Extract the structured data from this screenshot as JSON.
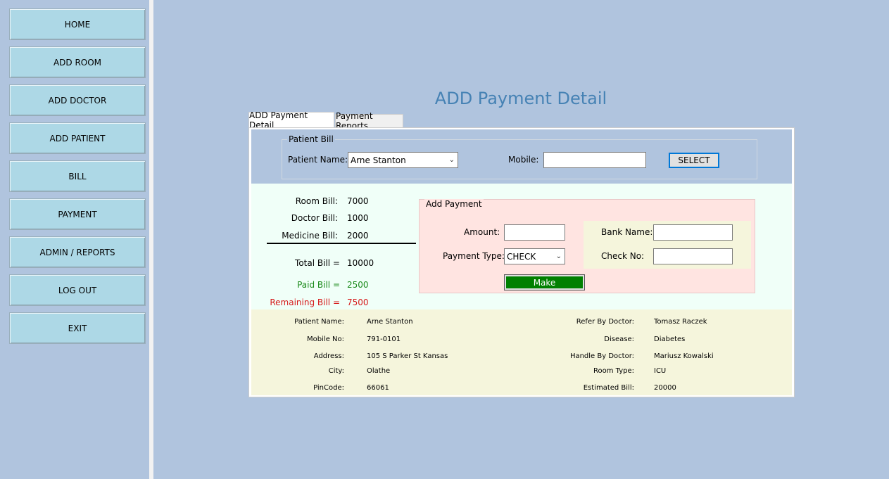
{
  "nav": {
    "items": [
      {
        "label": "HOME"
      },
      {
        "label": "ADD ROOM"
      },
      {
        "label": "ADD DOCTOR"
      },
      {
        "label": "ADD PATIENT"
      },
      {
        "label": "BILL"
      },
      {
        "label": "PAYMENT"
      },
      {
        "label": "ADMIN / REPORTS"
      },
      {
        "label": "LOG OUT"
      },
      {
        "label": "EXIT"
      }
    ]
  },
  "page": {
    "title": "ADD Payment Detail"
  },
  "tabs": [
    {
      "label": "ADD Payment Detail",
      "active": true
    },
    {
      "label": "Payment Reports",
      "active": false
    }
  ],
  "patient_bill": {
    "legend": "Patient Bill",
    "patient_name_label": "Patient Name:",
    "patient_name_value": "Arne Stanton",
    "mobile_label": "Mobile:",
    "mobile_value": "",
    "select_label": "SELECT"
  },
  "bill_summary": {
    "room_label": "Room Bill:",
    "room_value": "7000",
    "doctor_label": "Doctor Bill:",
    "doctor_value": "1000",
    "medicine_label": "Medicine Bill:",
    "medicine_value": "2000",
    "total_label": "Total Bill =",
    "total_value": "10000",
    "paid_label": "Paid Bill =",
    "paid_value": "2500",
    "remaining_label": "Remaining Bill =",
    "remaining_value": "7500"
  },
  "add_payment": {
    "legend": "Add Payment",
    "amount_label": "Amount:",
    "amount_value": "",
    "payment_type_label": "Payment Type:",
    "payment_type_value": "CHECK",
    "bank_name_label": "Bank Name:",
    "bank_name_value": "",
    "check_no_label": "Check No:",
    "check_no_value": "",
    "make_label": "Make"
  },
  "patient_info": {
    "left": [
      {
        "label": "Patient Name:",
        "value": "Arne Stanton"
      },
      {
        "label": "Mobile No:",
        "value": "791-0101"
      },
      {
        "label": "Address:",
        "value": "105 S Parker St Kansas"
      },
      {
        "label": "City:",
        "value": "Olathe"
      },
      {
        "label": "PinCode:",
        "value": "66061"
      }
    ],
    "right": [
      {
        "label": "Refer By Doctor:",
        "value": "Tomasz Raczek"
      },
      {
        "label": "Disease:",
        "value": "Diabetes"
      },
      {
        "label": "Handle By Doctor:",
        "value": "Mariusz Kowalski"
      },
      {
        "label": "Room Type:",
        "value": "ICU"
      },
      {
        "label": "Estimated Bill:",
        "value": "20000"
      }
    ]
  },
  "colors": {
    "background": "#b0c4de",
    "nav_button": "#add8e6",
    "title": "#4682b4",
    "paid": "#1a8a1a",
    "remaining": "#d61a1a",
    "make_button": "#008000"
  }
}
